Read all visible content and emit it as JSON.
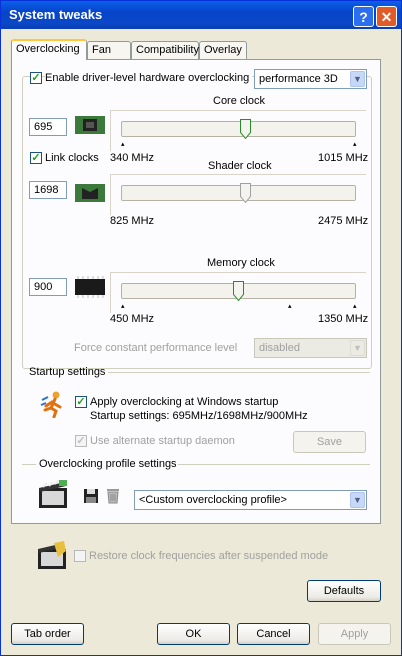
{
  "window": {
    "title": "System tweaks",
    "help_label": "?",
    "close_label": "✕"
  },
  "tabs": [
    {
      "label": "Overclocking",
      "active": true
    },
    {
      "label": "Fan"
    },
    {
      "label": "Compatibility"
    },
    {
      "label": "Overlay"
    }
  ],
  "overclocking": {
    "enable_label": "Enable driver-level hardware overclocking",
    "enable_checked": true,
    "mode_value": "performance 3D",
    "link_clocks_label": "Link clocks",
    "link_clocks_checked": true,
    "core": {
      "title": "Core clock",
      "value": "695",
      "min": "340 MHz",
      "max": "1015 MHz",
      "position": 0.53
    },
    "shader": {
      "title": "Shader clock",
      "value": "1698",
      "min": "825 MHz",
      "max": "2475 MHz",
      "position": 0.53
    },
    "memory": {
      "title": "Memory clock",
      "value": "900",
      "min": "450 MHz",
      "max": "1350 MHz",
      "position": 0.5
    },
    "force_label": "Force constant performance level",
    "force_value": "disabled"
  },
  "startup": {
    "header": "Startup settings",
    "apply_label": "Apply overclocking at Windows startup",
    "apply_checked": true,
    "settings_text": "Startup settings: 695MHz/1698MHz/900MHz",
    "daemon_label": "Use alternate startup daemon",
    "save_label": "Save"
  },
  "profile": {
    "header": "Overclocking profile settings",
    "value": "<Custom overclocking profile>"
  },
  "restore_label": "Restore clock frequencies after suspended mode",
  "buttons": {
    "defaults": "Defaults",
    "tab_order": "Tab order",
    "ok": "OK",
    "cancel": "Cancel",
    "apply": "Apply"
  }
}
